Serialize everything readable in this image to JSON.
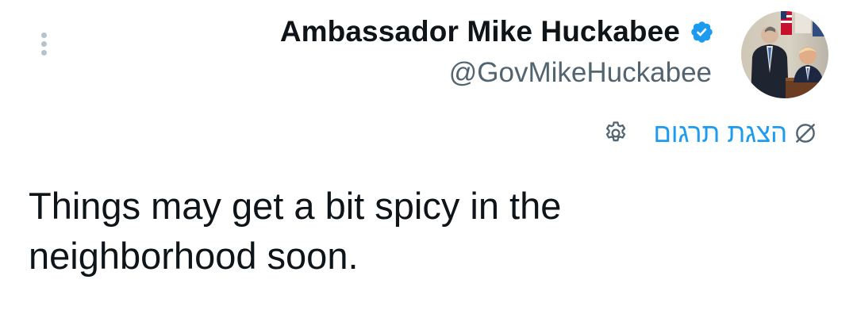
{
  "author": {
    "display_name": "Ambassador Mike Huckabee",
    "handle": "@GovMikeHuckabee",
    "verified": true
  },
  "icons": {
    "verified": "verified-badge-icon",
    "more": "more-vertical-icon",
    "settings": "gear-icon",
    "translate": "translate-globe-icon"
  },
  "translate": {
    "label": "הצגת תרגום"
  },
  "tweet": {
    "text": "Things may get a bit spicy in the\nneighborhood soon."
  },
  "colors": {
    "accent": "#1d9bf0",
    "text_primary": "#0f1419",
    "text_secondary": "#536471",
    "dots": "#b9c1ca"
  }
}
